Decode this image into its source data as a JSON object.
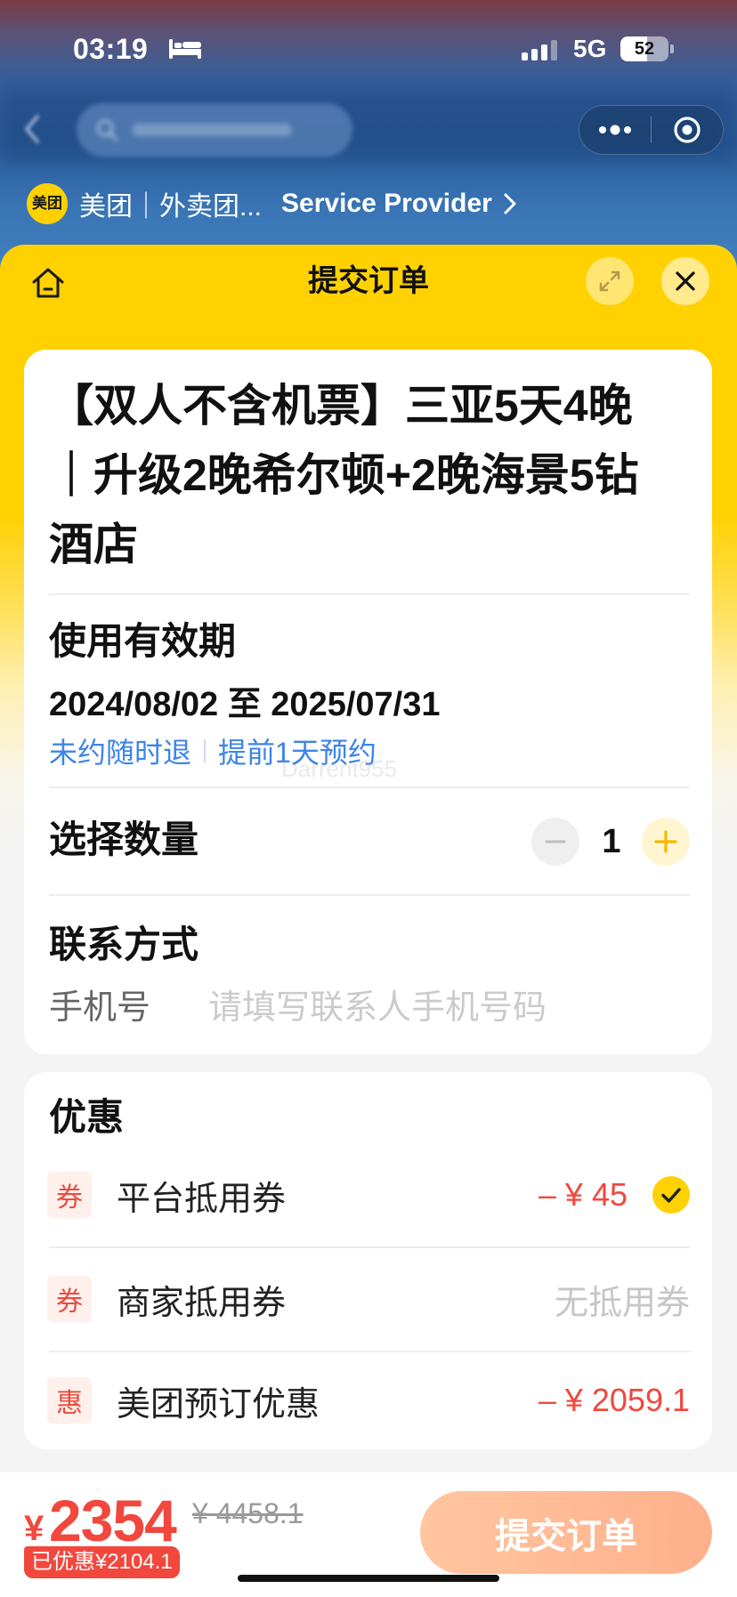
{
  "status_bar": {
    "time": "03:19",
    "network": "5G",
    "battery_level": "52",
    "focus_icon": "bed-icon",
    "signal_icon": "signal-icon"
  },
  "mini_program_bar": {
    "logo_text": "美团",
    "provider_name": "美团｜外卖团...",
    "provider_label": "Service Provider",
    "icons": [
      "more-dots-icon",
      "target-icon",
      "chevron-right-icon"
    ]
  },
  "header": {
    "title": "提交订单",
    "icons": [
      "home-icon",
      "expand-icon",
      "close-icon"
    ]
  },
  "product": {
    "title": "【双人不含机票】三亚5天4晚｜升级2晚希尔顿+2晚海景5钻酒店"
  },
  "validity": {
    "label": "使用有效期",
    "date_range": "2024/08/02 至 2025/07/31",
    "tags": [
      "未约随时退",
      "提前1天预约"
    ]
  },
  "quantity": {
    "label": "选择数量",
    "value": "1"
  },
  "contact": {
    "label": "联系方式",
    "field_label": "手机号",
    "placeholder": "请填写联系人手机号码"
  },
  "discounts": {
    "title": "优惠",
    "items": [
      {
        "tag": "券",
        "name": "平台抵用券",
        "amount": "– ¥ 45",
        "selected": true
      },
      {
        "tag": "券",
        "name": "商家抵用券",
        "amount": "无抵用券",
        "selected": false
      },
      {
        "tag": "惠",
        "name": "美团预订优惠",
        "amount": "– ¥ 2059.1",
        "selected": false
      }
    ]
  },
  "footer": {
    "currency": "¥",
    "price": "2354",
    "original_price": "¥ 4458.1",
    "saved_badge": "已优惠¥2104.1",
    "submit_label": "提交订单"
  },
  "watermark": "Darrent955",
  "colors": {
    "brand_yellow": "#FFD100",
    "price_red": "#F2473D",
    "link_blue": "#3C84E8",
    "submit_button": "#FFB08A",
    "page_background": "#F4F4F4"
  }
}
